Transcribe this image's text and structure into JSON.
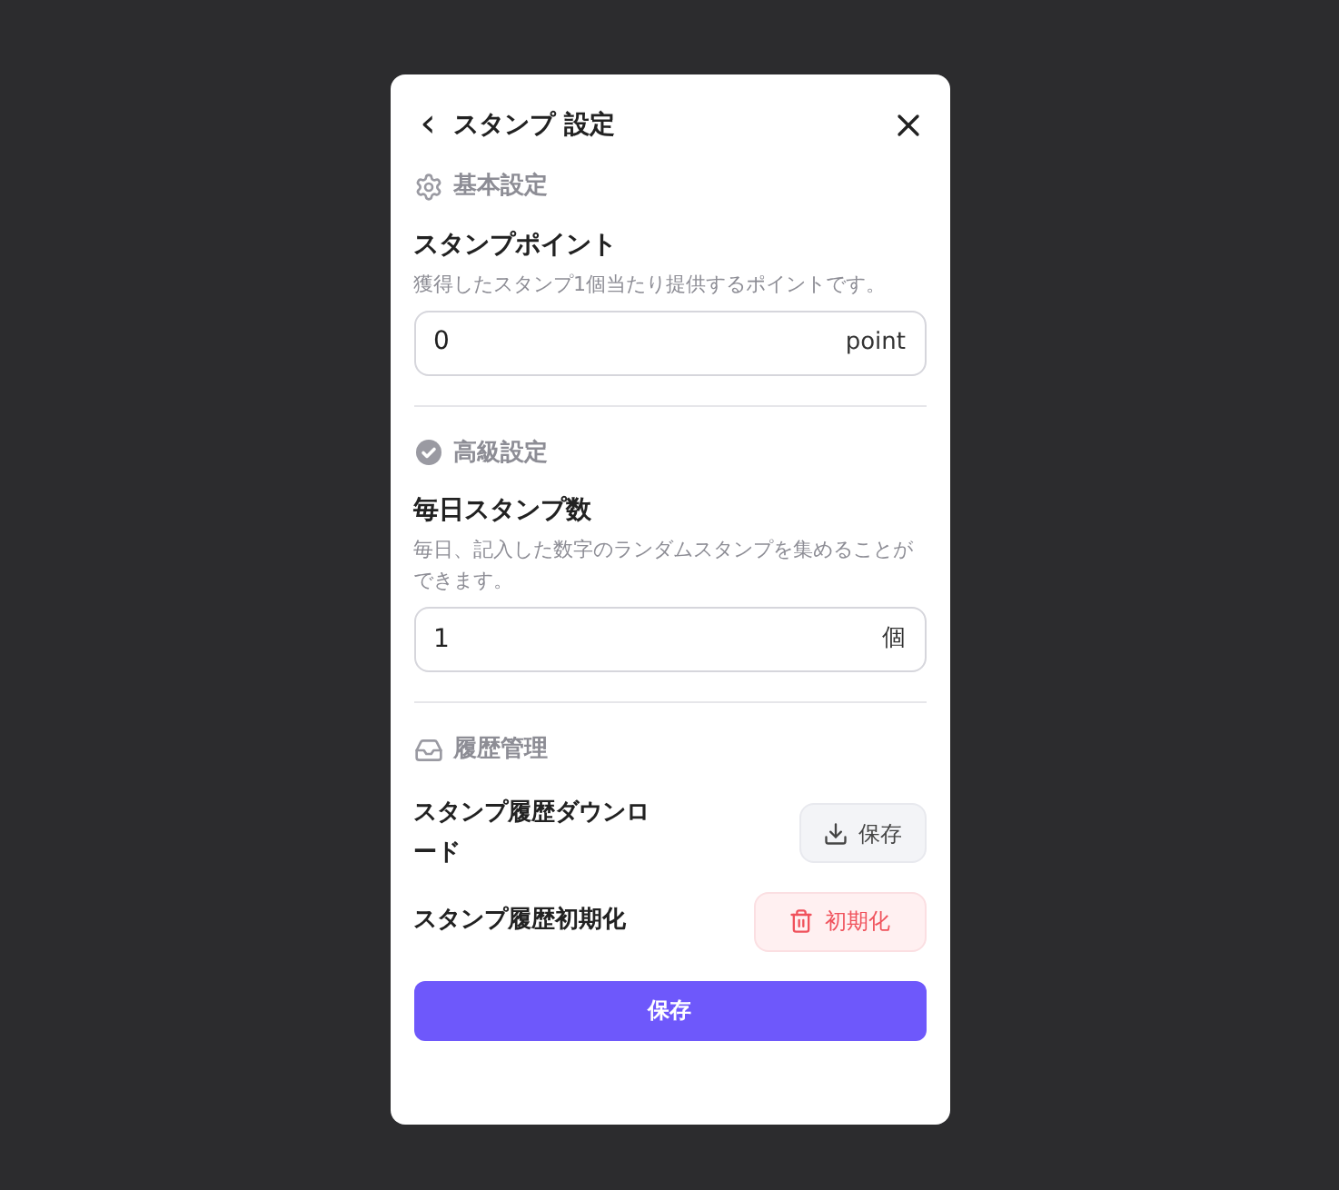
{
  "dialog": {
    "back": "‹",
    "title": "スタンプ 設定"
  },
  "sections": [
    {
      "kind": "basic",
      "heading": "基本設定",
      "field": {
        "label": "スタンプポイント",
        "description": "獲得したスタンプ1個当たり提供するポイントです。",
        "value": "0",
        "unit": "point"
      }
    },
    {
      "kind": "advanced",
      "heading": "高級設定",
      "field": {
        "label": "毎日スタンプ数",
        "description": "毎日、記入した数字のランダムスタンプを集めることができます。",
        "value": "1",
        "unit": "個"
      }
    },
    {
      "kind": "history",
      "heading": "履歴管理",
      "actions": [
        {
          "kind": "download",
          "label": "スタンプ履歴ダウンロード",
          "button": "保存"
        },
        {
          "kind": "reset",
          "label": "スタンプ履歴初期化",
          "button": "初期化"
        }
      ]
    }
  ],
  "save_button": "保存"
}
